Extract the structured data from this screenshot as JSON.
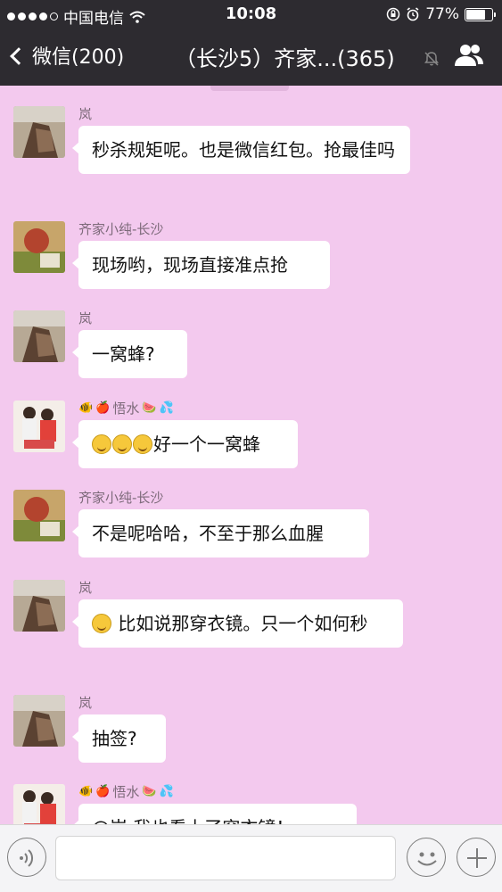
{
  "status_bar": {
    "carrier": "中国电信",
    "time": "10:08",
    "battery": "77%",
    "battery_level": 0.77
  },
  "nav": {
    "back_label": "微信(200)",
    "title": "（长沙5）齐家...(365)"
  },
  "messages": [
    {
      "sender": "岚",
      "text": "秒杀规矩呢。也是微信红包。抢最佳吗",
      "avatar": "avatar-lan"
    },
    {
      "sender": "齐家小纯-长沙",
      "text": "现场哟，现场直接准点抢",
      "avatar": "avatar-qijia"
    },
    {
      "sender": "岚",
      "text": "一窝蜂?",
      "avatar": "avatar-lan"
    },
    {
      "sender": "悟水",
      "text": "好一个一窝蜂",
      "avatar": "avatar-wushui"
    },
    {
      "sender": "齐家小纯-长沙",
      "text": "不是呢哈哈，不至于那么血腥",
      "avatar": "avatar-qijia"
    },
    {
      "sender": "岚",
      "text": "比如说那穿衣镜。只一个如何秒",
      "avatar": "avatar-lan"
    },
    {
      "sender": "岚",
      "text": "抽签?",
      "avatar": "avatar-lan"
    },
    {
      "sender": "悟水",
      "text": "@岚 我也看上了穿衣镜！",
      "avatar": "avatar-wushui"
    }
  ],
  "icons": {
    "back": "chevron-left-icon",
    "mute": "mute-icon",
    "members": "group-members-icon",
    "voice": "voice-icon",
    "emoji": "emoji-icon",
    "plus": "plus-icon"
  },
  "colors": {
    "nav_bg": "#2d2b30",
    "chat_bg": "#f3c9ee",
    "bubble": "#ffffff"
  }
}
